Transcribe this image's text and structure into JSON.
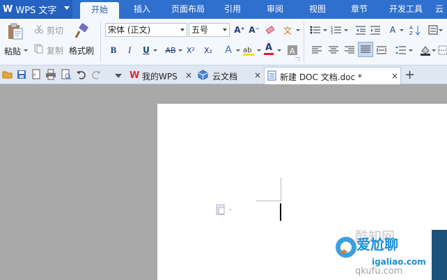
{
  "app": {
    "logo": "W",
    "name": "WPS 文字"
  },
  "ribbon_tabs": [
    "开始",
    "插入",
    "页面布局",
    "引用",
    "审阅",
    "视图",
    "章节",
    "开发工具",
    "云"
  ],
  "active_tab": "开始",
  "clipboard": {
    "paste": "粘贴",
    "cut": "剪切",
    "copy": "复制",
    "format_painter": "格式刷"
  },
  "font": {
    "family": "宋体 (正文)",
    "size": "五号"
  },
  "format_buttons": {
    "bold": "B",
    "italic": "I",
    "underline": "U",
    "strike": "AB",
    "superscript": "X²",
    "subscript": "X₂",
    "grow": "A⁺",
    "shrink": "A⁻",
    "font_color": "A",
    "highlight": "ab"
  },
  "doc_tabs": [
    {
      "label": "我的WPS",
      "close": "×"
    },
    {
      "label": "云文档",
      "close": "×"
    },
    {
      "label": "新建 DOC 文档.doc *",
      "close": "×"
    }
  ],
  "new_tab": "+",
  "watermark": {
    "line1": "爱尬聊",
    "line2": "igaliao.com",
    "line3": "qkufu.com",
    "ghost": "酷知网"
  },
  "colors": {
    "title_bar": "#2f6fcd",
    "ribbon_bg": "#f4f7fb",
    "workspace": "#a9a9a9",
    "wps_red": "#d9282f",
    "watermark_blue": "#1a8fd8"
  }
}
